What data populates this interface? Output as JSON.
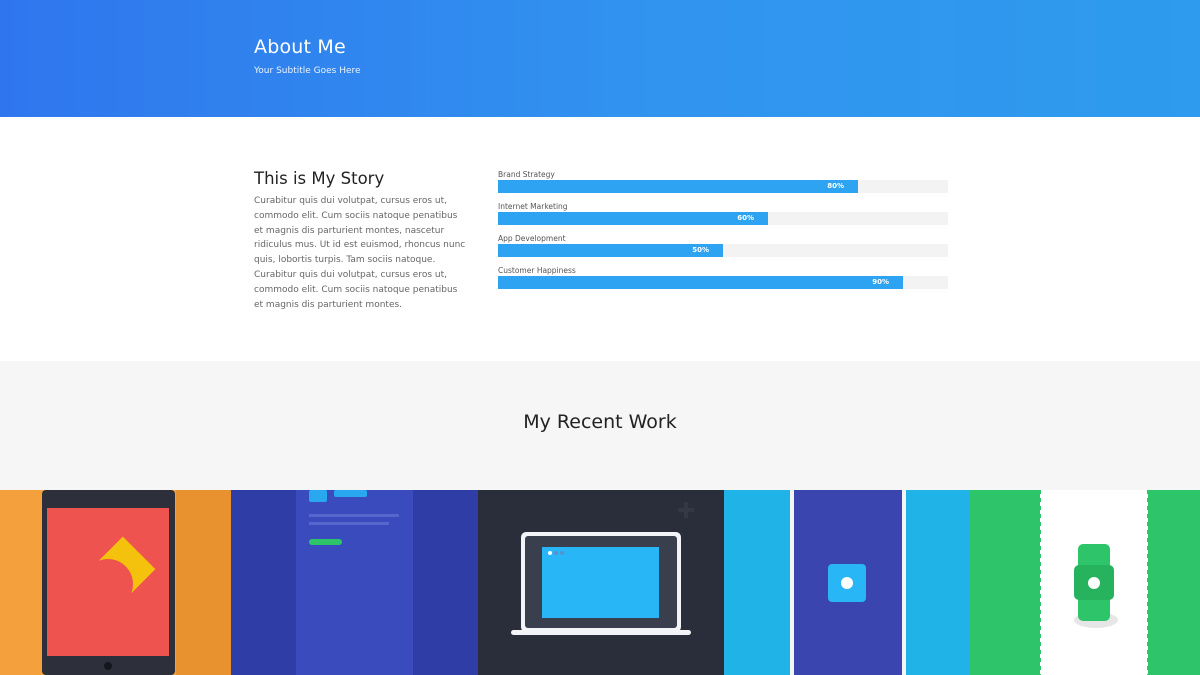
{
  "hero": {
    "title": "About Me",
    "subtitle": "Your Subtitle Goes Here"
  },
  "story": {
    "title": "This is My Story",
    "body": "Curabitur quis dui volutpat, cursus eros ut, commodo elit. Cum sociis natoque penatibus et magnis dis parturient montes, nascetur ridiculus mus. Ut id est euismod, rhoncus nunc quis, lobortis turpis. Tam sociis natoque. Curabitur quis dui volutpat, cursus eros ut, commodo elit. Cum sociis natoque penatibus et magnis dis parturient montes."
  },
  "skills": [
    {
      "label": "Brand Strategy",
      "percent_text": "80%",
      "value": 80
    },
    {
      "label": "Internet Marketing",
      "percent_text": "60%",
      "value": 60
    },
    {
      "label": "App Development",
      "percent_text": "50%",
      "value": 50
    },
    {
      "label": "Customer Happiness",
      "percent_text": "90%",
      "value": 90
    }
  ],
  "recent_work": {
    "title": "My Recent Work"
  },
  "portfolio": [
    {
      "name": "tablet-shapes",
      "icon": "tablet-icon",
      "bg": "#f4a03c"
    },
    {
      "name": "mobile-layout",
      "icon": "mobile-layout-icon",
      "bg": "#3345b3"
    },
    {
      "name": "laptop",
      "icon": "laptop-icon",
      "bg": "#2a2e3a"
    },
    {
      "name": "app-screens",
      "icon": "app-screen-icon",
      "bg": "#1fb3e8"
    },
    {
      "name": "smartwatch",
      "icon": "smartwatch-icon",
      "bg": "#2ec46a"
    }
  ],
  "colors": {
    "hero_start": "#2f76ee",
    "hero_end": "#2e9bee",
    "bar_fill": "#2ea3f2",
    "bar_track": "#f3f3f3",
    "section_gray": "#f6f6f6"
  }
}
